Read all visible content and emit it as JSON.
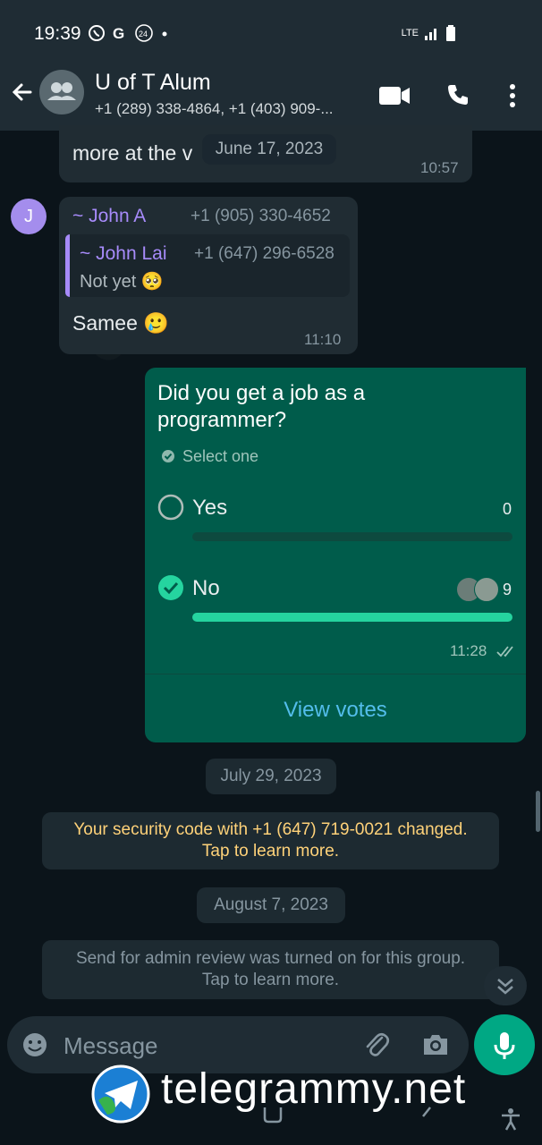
{
  "status_bar": {
    "time": "19:39",
    "icons": [
      "viber-icon",
      "google-icon",
      "24-badge-icon",
      "dot-icon"
    ],
    "network": "LTE"
  },
  "header": {
    "title": "U of T Alum",
    "subtitle": "+1 (289) 338-4864, +1 (403) 909-..."
  },
  "messages": {
    "partial": {
      "text": "more at the v",
      "date_overlay": "June 17, 2023",
      "time": "10:57"
    },
    "john_a": {
      "avatar_letter": "J",
      "sender": "~ John A",
      "sender_phone": "+1 (905) 330-4652",
      "quote_sender": "~ John Lai",
      "quote_phone": "+1 (647) 296-6528",
      "quote_text": "Not yet 🥺",
      "text": "Samee 🥲",
      "time": "11:10"
    },
    "poll": {
      "question_line1": "Did you get a job as a",
      "question_line2": "programmer?",
      "hint": "Select one",
      "options": [
        {
          "label": "Yes",
          "count": "0",
          "fraction": 0,
          "selected": false
        },
        {
          "label": "No",
          "count": "9",
          "fraction": 1,
          "selected": true
        }
      ],
      "time": "11:28",
      "view_votes": "View votes"
    }
  },
  "date_chips": {
    "first": "July 29, 2023",
    "second": "August 7, 2023"
  },
  "system": {
    "security_line1": "Your security code with +1 (647) 719-0021 changed.",
    "security_line2": "Tap to learn more.",
    "admin_line1": "Send for admin review was turned on for this group.",
    "admin_line2": "Tap to learn more."
  },
  "composer": {
    "placeholder": "Message"
  },
  "watermark": {
    "text": "telegrammy.net"
  },
  "colors": {
    "accent": "#00a884",
    "outgoing_bubble": "#005c4b",
    "incoming_bubble": "#202c33",
    "sender_name": "#a78bfa",
    "system_text": "#ffd279",
    "link": "#53bdeb"
  }
}
